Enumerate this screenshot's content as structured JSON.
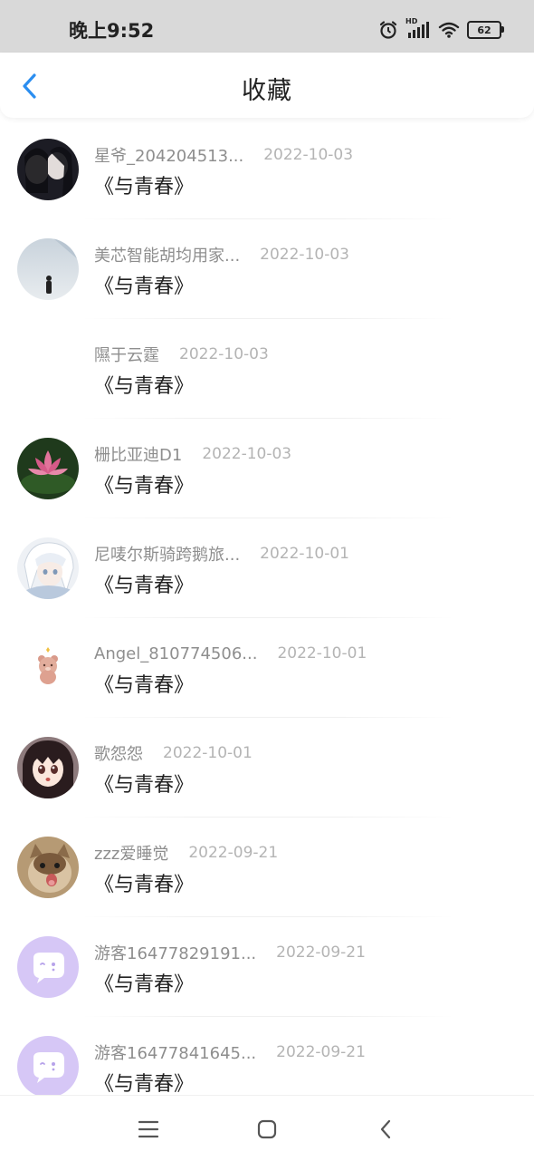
{
  "status_bar": {
    "time": "晚上9:52",
    "battery": "62",
    "hd": "HD",
    "icons": [
      "alarm-icon",
      "signal-icon",
      "wifi-icon",
      "battery-icon"
    ]
  },
  "header": {
    "title": "收藏",
    "back_icon": "chevron-left-icon",
    "accent_color": "#2b8ef0"
  },
  "favorites": [
    {
      "username": "星爷_204204513...",
      "date": "2022-10-03",
      "book": "《与青春》",
      "avatar": "photo-girls"
    },
    {
      "username": "美芯智能胡均用家...",
      "date": "2022-10-03",
      "book": "《与青春》",
      "avatar": "photo-man-fog"
    },
    {
      "username": "隰于云霆",
      "date": "2022-10-03",
      "book": "《与青春》",
      "avatar": "none"
    },
    {
      "username": "栅比亚迪D1",
      "date": "2022-10-03",
      "book": "《与青春》",
      "avatar": "photo-lotus"
    },
    {
      "username": "尼唛尔斯骑跨鹅旅...",
      "date": "2022-10-01",
      "book": "《与青春》",
      "avatar": "anime-white-hair"
    },
    {
      "username": "Angel_810774506...",
      "date": "2022-10-01",
      "book": "《与青春》",
      "avatar": "bear-sticker"
    },
    {
      "username": "歌怨怨",
      "date": "2022-10-01",
      "book": "《与青春》",
      "avatar": "anime-girl"
    },
    {
      "username": "zzz爱睡觉",
      "date": "2022-09-21",
      "book": "《与青春》",
      "avatar": "photo-cat"
    },
    {
      "username": "游客16477829191...",
      "date": "2022-09-21",
      "book": "《与青春》",
      "avatar": "default-chat-bubble"
    },
    {
      "username": "游客16477841645...",
      "date": "2022-09-21",
      "book": "《与青春》",
      "avatar": "default-chat-bubble"
    }
  ],
  "nav_bar": {
    "icons": [
      "menu-icon",
      "home-icon",
      "back-icon"
    ]
  }
}
